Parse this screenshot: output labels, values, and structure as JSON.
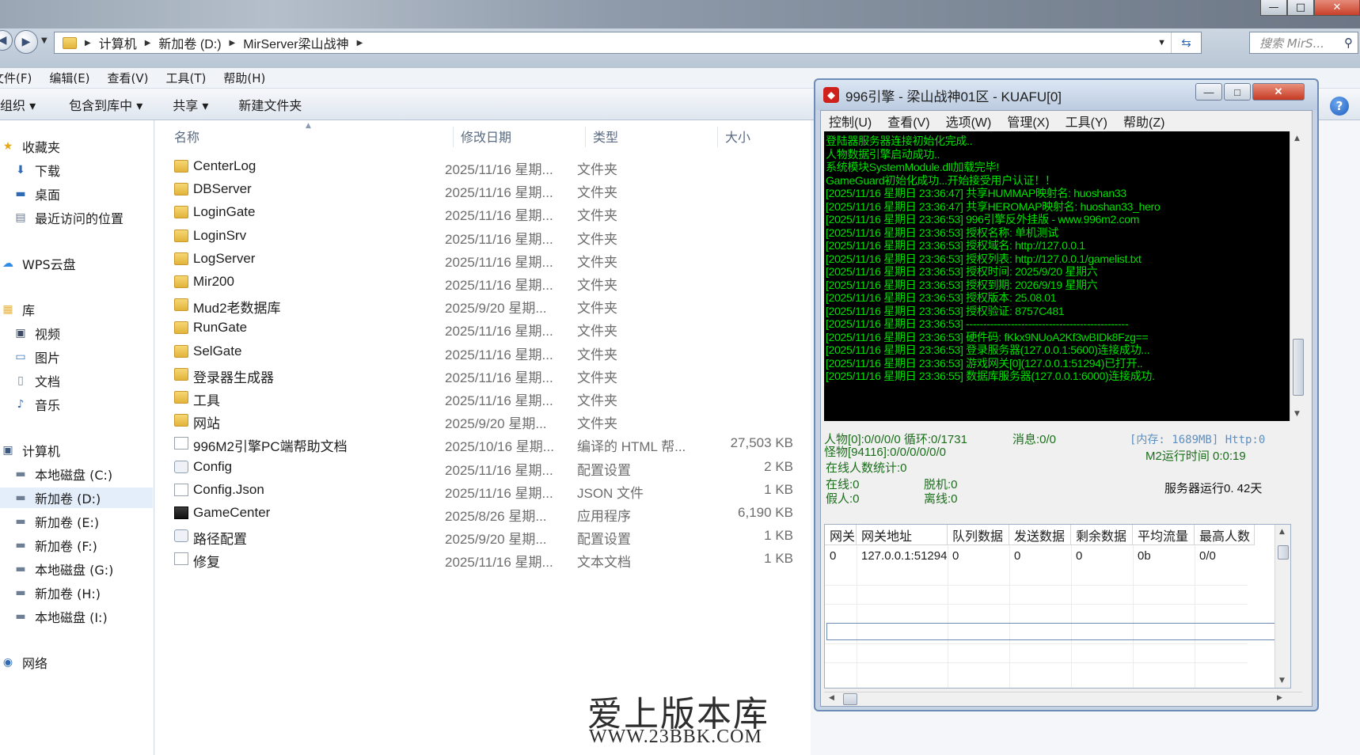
{
  "window_controls": {
    "min": "—",
    "max": "□",
    "close": "✕"
  },
  "address_bar": {
    "crumbs": [
      "计算机",
      "新加卷 (D:)",
      "MirServer梁山战神"
    ],
    "search_placeholder": "搜索 MirS..."
  },
  "menu": [
    "文件(F)",
    "编辑(E)",
    "查看(V)",
    "工具(T)",
    "帮助(H)"
  ],
  "toolbar": [
    "组织 ▾",
    "包含到库中 ▾",
    "共享 ▾",
    "新建文件夹"
  ],
  "nav": {
    "favorites": "收藏夹",
    "fav_items": [
      "下载",
      "桌面",
      "最近访问的位置"
    ],
    "wps": "WPS云盘",
    "library": "库",
    "lib_items": [
      "视频",
      "图片",
      "文档",
      "音乐"
    ],
    "computer": "计算机",
    "drives": [
      "本地磁盘 (C:)",
      "新加卷 (D:)",
      "新加卷 (E:)",
      "新加卷 (F:)",
      "本地磁盘 (G:)",
      "新加卷 (H:)",
      "本地磁盘 (I:)"
    ],
    "network": "网络"
  },
  "columns": {
    "name": "名称",
    "date": "修改日期",
    "type": "类型",
    "size": "大小"
  },
  "files": [
    {
      "name": "CenterLog",
      "date": "2025/11/16 星期...",
      "type": "文件夹",
      "size": "",
      "icon": "folder"
    },
    {
      "name": "DBServer",
      "date": "2025/11/16 星期...",
      "type": "文件夹",
      "size": "",
      "icon": "folder"
    },
    {
      "name": "LoginGate",
      "date": "2025/11/16 星期...",
      "type": "文件夹",
      "size": "",
      "icon": "folder"
    },
    {
      "name": "LoginSrv",
      "date": "2025/11/16 星期...",
      "type": "文件夹",
      "size": "",
      "icon": "folder"
    },
    {
      "name": "LogServer",
      "date": "2025/11/16 星期...",
      "type": "文件夹",
      "size": "",
      "icon": "folder"
    },
    {
      "name": "Mir200",
      "date": "2025/11/16 星期...",
      "type": "文件夹",
      "size": "",
      "icon": "folder"
    },
    {
      "name": "Mud2老数据库",
      "date": "2025/9/20 星期...",
      "type": "文件夹",
      "size": "",
      "icon": "folder"
    },
    {
      "name": "RunGate",
      "date": "2025/11/16 星期...",
      "type": "文件夹",
      "size": "",
      "icon": "folder"
    },
    {
      "name": "SelGate",
      "date": "2025/11/16 星期...",
      "type": "文件夹",
      "size": "",
      "icon": "folder"
    },
    {
      "name": "登录器生成器",
      "date": "2025/11/16 星期...",
      "type": "文件夹",
      "size": "",
      "icon": "folder"
    },
    {
      "name": "工具",
      "date": "2025/11/16 星期...",
      "type": "文件夹",
      "size": "",
      "icon": "folder"
    },
    {
      "name": "网站",
      "date": "2025/9/20 星期...",
      "type": "文件夹",
      "size": "",
      "icon": "folder"
    },
    {
      "name": "996M2引擎PC端帮助文档",
      "date": "2025/10/16 星期...",
      "type": "编译的 HTML 帮...",
      "size": "27,503 KB",
      "icon": "chm"
    },
    {
      "name": "Config",
      "date": "2025/11/16 星期...",
      "type": "配置设置",
      "size": "2 KB",
      "icon": "cfg"
    },
    {
      "name": "Config.Json",
      "date": "2025/11/16 星期...",
      "type": "JSON 文件",
      "size": "1 KB",
      "icon": "doc"
    },
    {
      "name": "GameCenter",
      "date": "2025/8/26 星期...",
      "type": "应用程序",
      "size": "6,190 KB",
      "icon": "exe"
    },
    {
      "name": "路径配置",
      "date": "2025/9/20 星期...",
      "type": "配置设置",
      "size": "1 KB",
      "icon": "cfg"
    },
    {
      "name": "修复",
      "date": "2025/11/16 星期...",
      "type": "文本文档",
      "size": "1 KB",
      "icon": "doc"
    }
  ],
  "game": {
    "title": "996引擎 - 梁山战神01区 - KUAFU[0]",
    "menu": [
      "控制(U)",
      "查看(V)",
      "选项(W)",
      "管理(X)",
      "工具(Y)",
      "帮助(Z)"
    ],
    "log": [
      "登陆器服务器连接初始化完成..",
      "人物数据引擎启动成功..",
      "系统模块SystemModule.dll加载完毕!",
      "GameGuard初始化成功...开始接受用户认证！！",
      "[2025/11/16 星期日 23:36:47] 共享HUMMAP映射名: huoshan33",
      "[2025/11/16 星期日 23:36:47] 共享HEROMAP映射名: huoshan33_hero",
      "[2025/11/16 星期日 23:36:53] 996引擎反外挂版 - www.996m2.com",
      "[2025/11/16 星期日 23:36:53] 授权名称: 单机测试",
      "[2025/11/16 星期日 23:36:53] 授权域名: http://127.0.0.1",
      "[2025/11/16 星期日 23:36:53] 授权列表: http://127.0.0.1/gamelist.txt",
      "[2025/11/16 星期日 23:36:53] 授权时间: 2025/9/20 星期六",
      "[2025/11/16 星期日 23:36:53] 授权到期: 2026/9/19 星期六",
      "[2025/11/16 星期日 23:36:53] 授权版本: 25.08.01",
      "[2025/11/16 星期日 23:36:53] 授权验证: 8757C481",
      "[2025/11/16 星期日 23:36:53] -----------------------------------------------",
      "[2025/11/16 星期日 23:36:53] 硬件码: fKkx9NUoA2Kf3wBIDk8Fzg==",
      "[2025/11/16 星期日 23:36:53] 登录服务器(127.0.0.1:5600)连接成功...",
      "[2025/11/16 星期日 23:36:53] 游戏网关[0](127.0.0.1:51294)已打开..",
      "[2025/11/16 星期日 23:36:55] 数据库服务器(127.0.0.1:6000)连接成功."
    ],
    "stats": {
      "line1": "人物[0]:0/0/0/0 循环:0/1731",
      "msg": "消息:0/0",
      "mem": "[内存: 1689MB] Http:0",
      "line2": "怪物[94116]:0/0/0/0/0/0",
      "m2time": "M2运行时间 0:0:19",
      "online_stat": "在线人数统计:0",
      "online": "在线:0",
      "offline": "脱机:0",
      "fake": "假人:0",
      "left": "离线:0",
      "server_run": "服务器运行0. 42天"
    },
    "grid_headers": [
      "网关",
      "网关地址",
      "队列数据",
      "发送数据",
      "剩余数据",
      "平均流量",
      "最高人数"
    ],
    "grid_row": [
      "0",
      "127.0.0.1:51294",
      "0",
      "0",
      "0",
      "0b",
      "0/0"
    ]
  },
  "watermark": {
    "line1": "爱上版本库",
    "line2": "WWW.23BBK.COM"
  }
}
